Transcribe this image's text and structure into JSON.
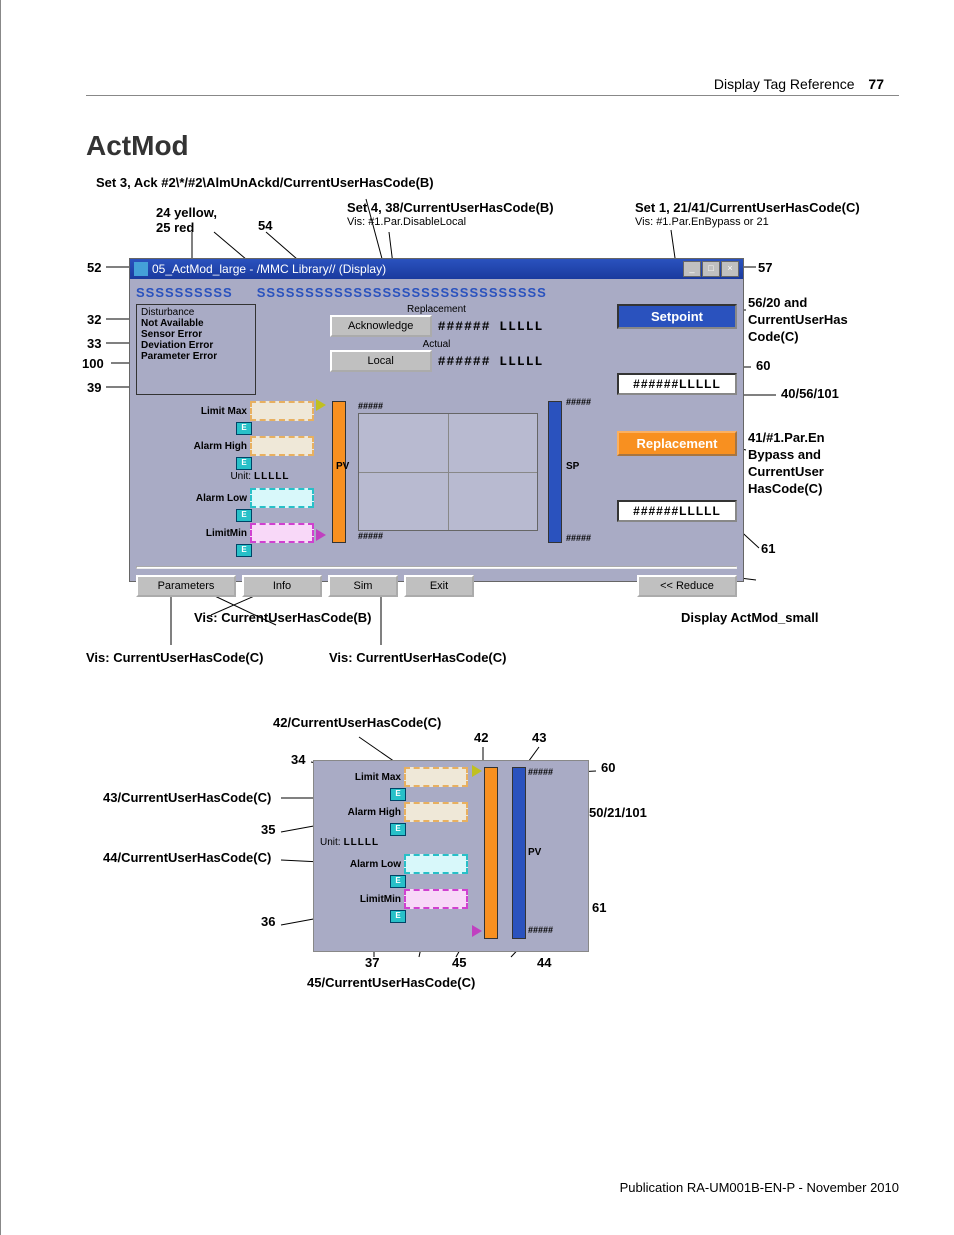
{
  "header": {
    "section": "Display Tag Reference",
    "page": "77"
  },
  "title": "ActMod",
  "footer": "Publication RA-UM001B-EN-P - November 2010",
  "callouts": {
    "c1": "Set 3, Ack #2\\*/#2\\AlmUnAckd/CurrentUserHasCode(B)",
    "c2": "24 yellow,",
    "c2b": "25 red",
    "c3": "54",
    "c4": "Set 4, 38/CurrentUserHasCode(B)",
    "c4s": "Vis: #1.Par.DisableLocal",
    "c5": "Set 1, 21/41/CurrentUserHasCode(C)",
    "c5s": "Vis: #1.Par.EnBypass or 21",
    "l52": "52",
    "l32": "32",
    "l33": "33",
    "l100": "100",
    "l39": "39",
    "r57": "57",
    "r56": "56/20 and",
    "r56b": "CurrentUserHas",
    "r56c": "Code(C)",
    "r60": "60",
    "r40": "40/56/101",
    "r41": "41/#1.Par.En",
    "r41b": "Bypass and",
    "r41c": "CurrentUser",
    "r41d": "HasCode(C)",
    "r61": "61",
    "bVisB": "Vis: CurrentUserHasCode(B)",
    "bVisC": "Vis: CurrentUserHasCode(C)",
    "bVisC2": "Vis: CurrentUserHasCode(C)",
    "bDisp": "Display ActMod_small",
    "d42c": "42/CurrentUserHasCode(C)",
    "d34": "34",
    "d43c": "43/CurrentUserHasCode(C)",
    "d35": "35",
    "d44c": "44/CurrentUserHasCode(C)",
    "d36": "36",
    "d37": "37",
    "d45": "45",
    "d44": "44",
    "d42": "42",
    "d43": "43",
    "d60": "60",
    "d50": "50/21/101",
    "d61": "61",
    "d45c": "45/CurrentUserHasCode(C)"
  },
  "window": {
    "title": "05_ActMod_large - /MMC Library// (Display)",
    "s1": "SSSSSSSSSS",
    "s2": "SSSSSSSSSSSSSSSSSSSSSSSSSSSSSS",
    "errs": [
      "Disturbance",
      "Not Available",
      "Sensor Error",
      "Deviation Error",
      "Parameter Error"
    ],
    "btnAck": "Acknowledge",
    "btnLocal": "Local",
    "lblRepl": "Replacement",
    "lblAct": "Actual",
    "val1": "###### LLLLL",
    "val2": "###### LLLLL",
    "limMax": "Limit Max",
    "almHi": "Alarm High",
    "unit": "Unit:",
    "unitV": "LLLLL",
    "almLo": "Alarm Low",
    "limMin": "LimitMin",
    "pv": "PV",
    "sp": "SP",
    "hmax": "#####",
    "hmin": "#####",
    "setpt": "Setpoint",
    "repl": "Replacement",
    "rv1": "######LLLLL",
    "rv2": "######LLLLL",
    "params": "Parameters",
    "info": "Info",
    "sim": "Sim",
    "exit": "Exit",
    "reduce": "<< Reduce",
    "e": "E"
  }
}
